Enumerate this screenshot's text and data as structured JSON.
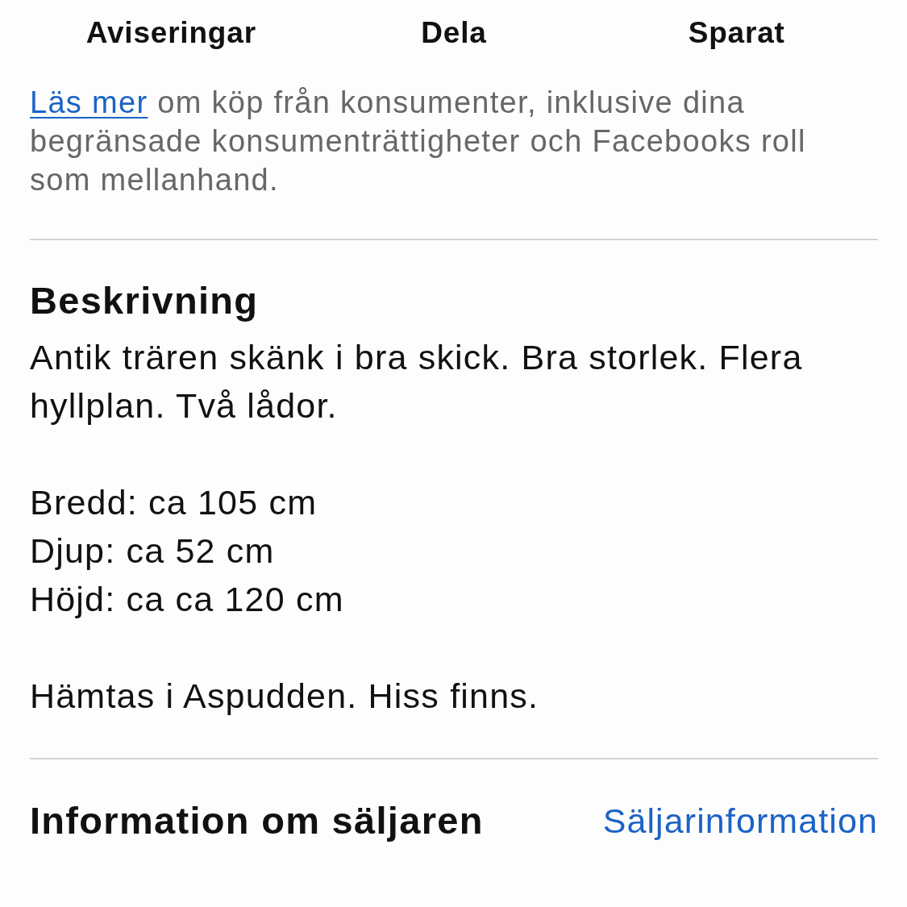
{
  "actions": [
    {
      "label": "Aviseringar"
    },
    {
      "label": "Dela"
    },
    {
      "label": "Sparat"
    }
  ],
  "notice": {
    "link": "Läs mer",
    "text": "om köp från konsumenter, inklusive dina begränsade konsumenträttigheter och Facebooks roll som mellanhand."
  },
  "description": {
    "title": "Beskrivning",
    "paragraphs": [
      {
        "lines": [
          "Antik trären skänk i bra skick. Bra storlek. Flera hyllplan. Två lådor."
        ]
      },
      {
        "lines": [
          "Bredd: ca 105 cm",
          "Djup: ca 52 cm",
          "Höjd: ca ca 120 cm"
        ]
      },
      {
        "lines": [
          "Hämtas i Aspudden. Hiss finns."
        ]
      }
    ]
  },
  "seller": {
    "title": "Information om säljaren",
    "link": "Säljarinformation"
  }
}
